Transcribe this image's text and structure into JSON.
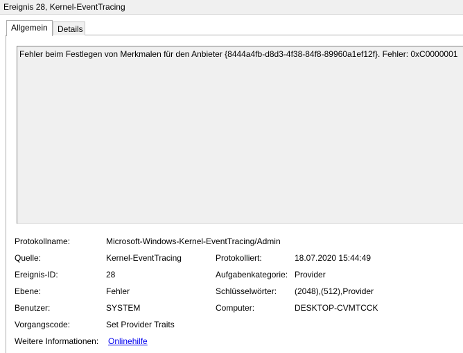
{
  "window": {
    "title": "Ereignis 28, Kernel-EventTracing"
  },
  "tabs": [
    {
      "label": "Allgemein",
      "active": true
    },
    {
      "label": "Details",
      "active": false
    }
  ],
  "message": "Fehler beim Festlegen von Merkmalen für den Anbieter {8444a4fb-d8d3-4f38-84f8-89960a1ef12f}. Fehler: 0xC0000001",
  "details": {
    "protokollname": {
      "label": "Protokollname:",
      "value": "Microsoft-Windows-Kernel-EventTracing/Admin"
    },
    "quelle": {
      "label": "Quelle:",
      "value": "Kernel-EventTracing"
    },
    "protokolliert": {
      "label": "Protokolliert:",
      "value": "18.07.2020 15:44:49"
    },
    "ereignis_id": {
      "label": "Ereignis-ID:",
      "value": "28"
    },
    "aufgabenkategorie": {
      "label": "Aufgabenkategorie:",
      "value": "Provider"
    },
    "ebene": {
      "label": "Ebene:",
      "value": "Fehler"
    },
    "schluesselwoerter": {
      "label": "Schlüsselwörter:",
      "value": "(2048),(512),Provider"
    },
    "benutzer": {
      "label": "Benutzer:",
      "value": "SYSTEM"
    },
    "computer": {
      "label": "Computer:",
      "value": "DESKTOP-CVMTCCK"
    },
    "vorgangscode": {
      "label": "Vorgangscode:",
      "value": "Set Provider Traits"
    },
    "weitere_informationen": {
      "label": "Weitere Informationen:",
      "link": "Onlinehilfe"
    }
  },
  "colors": {
    "link": "#0000ee",
    "message_background": "#f0f0f0",
    "titlebar_background": "#f0f0f0"
  }
}
